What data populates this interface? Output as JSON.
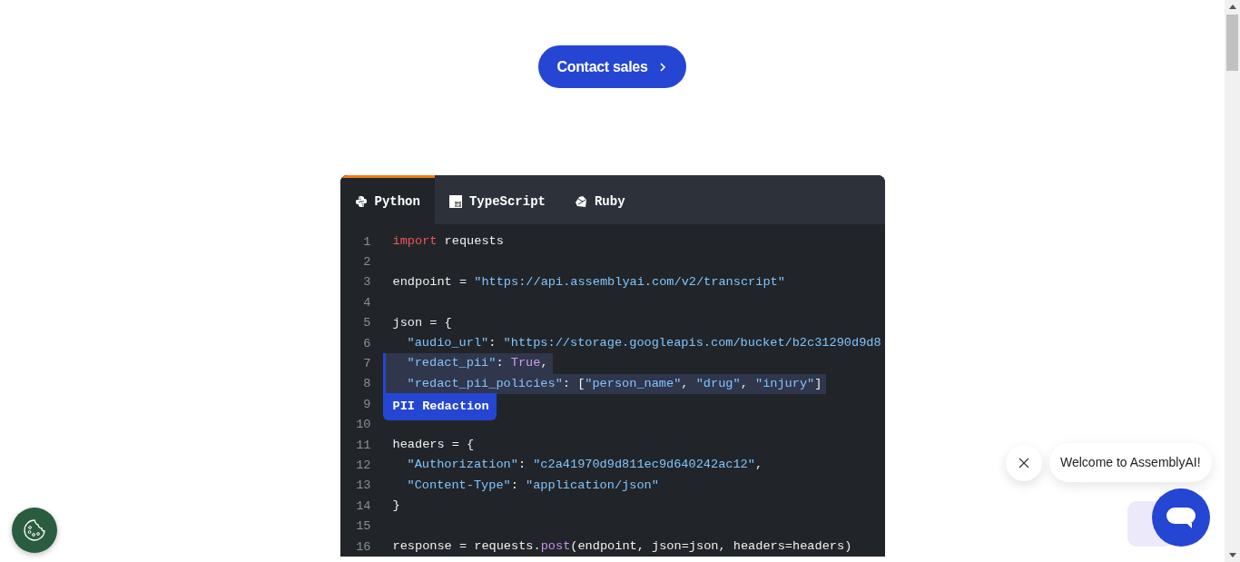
{
  "cta": {
    "label": "Contact sales"
  },
  "code_panel": {
    "tabs": [
      {
        "label": "Python",
        "selected": true
      },
      {
        "label": "TypeScript",
        "selected": false
      },
      {
        "label": "Ruby",
        "selected": false
      }
    ],
    "lines": [
      {
        "number": "1",
        "highlighted": false,
        "tokens": [
          {
            "kind": "keyword",
            "text": "import"
          },
          {
            "kind": "plain",
            "text": " requests"
          }
        ]
      },
      {
        "number": "2",
        "highlighted": false
      },
      {
        "number": "3",
        "highlighted": false,
        "tokens": [
          {
            "kind": "plain",
            "text": "endpoint = "
          },
          {
            "kind": "string",
            "text": "\"https://api.assemblyai.com/v2/transcript\""
          }
        ]
      },
      {
        "number": "4",
        "highlighted": false
      },
      {
        "number": "5",
        "highlighted": false,
        "tokens": [
          {
            "kind": "plain",
            "text": "json = {"
          }
        ]
      },
      {
        "number": "6",
        "highlighted": false,
        "indented": true,
        "tokens": [
          {
            "kind": "string",
            "text": "\"audio_url\""
          },
          {
            "kind": "plain",
            "text": ": "
          },
          {
            "kind": "string",
            "text": "\"https://storage.googleapis.com/bucket/b2c31290d9d8"
          }
        ]
      },
      {
        "number": "7",
        "highlighted": true,
        "indented": true,
        "tokens": [
          {
            "kind": "string",
            "text": "\"redact_pii\""
          },
          {
            "kind": "plain",
            "text": ": "
          },
          {
            "kind": "constant",
            "text": "True"
          },
          {
            "kind": "plain",
            "text": ","
          }
        ]
      },
      {
        "number": "8",
        "highlighted": true,
        "indented": true,
        "tokens": [
          {
            "kind": "string",
            "text": "\"redact_pii_policies\""
          },
          {
            "kind": "plain",
            "text": ": ["
          },
          {
            "kind": "string",
            "text": "\"person_name\""
          },
          {
            "kind": "plain",
            "text": ", "
          },
          {
            "kind": "string",
            "text": "\"drug\""
          },
          {
            "kind": "plain",
            "text": ", "
          },
          {
            "kind": "string",
            "text": "\"injury\""
          },
          {
            "kind": "plain",
            "text": "]"
          }
        ]
      },
      {
        "number": "9",
        "highlighted": false,
        "badge": "PII Redaction"
      },
      {
        "number": "10",
        "highlighted": false
      },
      {
        "number": "11",
        "highlighted": false,
        "tokens": [
          {
            "kind": "plain",
            "text": "headers = {"
          }
        ]
      },
      {
        "number": "12",
        "highlighted": false,
        "indented": true,
        "tokens": [
          {
            "kind": "string",
            "text": "\"Authorization\""
          },
          {
            "kind": "plain",
            "text": ": "
          },
          {
            "kind": "string",
            "text": "\"c2a41970d9d811ec9d640242ac12\""
          },
          {
            "kind": "plain",
            "text": ","
          }
        ]
      },
      {
        "number": "13",
        "highlighted": false,
        "indented": true,
        "tokens": [
          {
            "kind": "string",
            "text": "\"Content-Type\""
          },
          {
            "kind": "plain",
            "text": ": "
          },
          {
            "kind": "string",
            "text": "\"application/json\""
          }
        ]
      },
      {
        "number": "14",
        "highlighted": false,
        "tokens": [
          {
            "kind": "plain",
            "text": "}"
          }
        ]
      },
      {
        "number": "15",
        "highlighted": false
      },
      {
        "number": "16",
        "highlighted": false,
        "tokens": [
          {
            "kind": "plain",
            "text": "response = requests."
          },
          {
            "kind": "function",
            "text": "post"
          },
          {
            "kind": "plain",
            "text": "(endpoint, json=json, headers=headers)"
          }
        ]
      }
    ]
  },
  "chat": {
    "message": "Welcome to AssemblyAI!"
  }
}
